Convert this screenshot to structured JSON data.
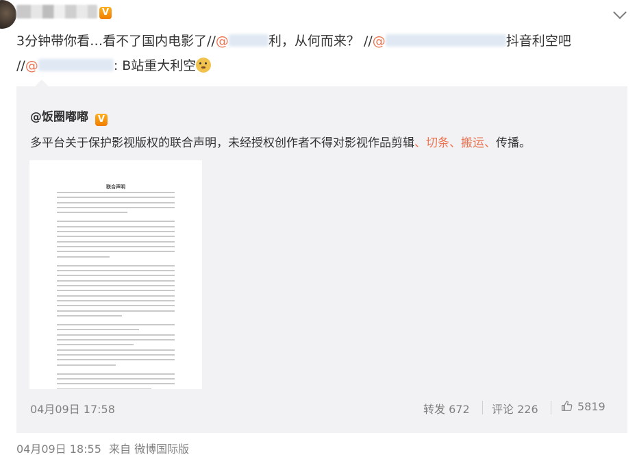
{
  "post": {
    "text_intro": "3分钟带你看…看不了国内电影了//",
    "mention1_start": "@",
    "text_after_mention1": "利，从何而来？",
    "repost_sep2": " //",
    "mention2_start": "@",
    "text_after_mention2": "抖音利空吧",
    "repost_sep3": "//",
    "mention3_start": "@",
    "text_after_mention3": ": B站重大利空",
    "emoji": "doge-icon"
  },
  "quote": {
    "author": "@饭圈嘟嘟",
    "verified_badge": "V",
    "text_before": "多平台关于保护影视版权的联合声明，未经授权创作者不得对影视作品剪辑",
    "kw_sep1": "、",
    "kw1": "切条",
    "kw_sep2": "、",
    "kw2": "搬运",
    "kw_sep3": "、",
    "text_after": "传播。",
    "image": {
      "doc_title": "联合声明"
    },
    "date": "04月09日 17:58",
    "repost_label": "转发 672",
    "comment_label": "评论 226",
    "like_count": "5819"
  },
  "footer": {
    "date": "04月09日 18:55",
    "source": "来自 微博国际版"
  },
  "colors": {
    "accent": "#eb7350",
    "quote_bg": "#f2f2f5",
    "meta": "#808080"
  }
}
